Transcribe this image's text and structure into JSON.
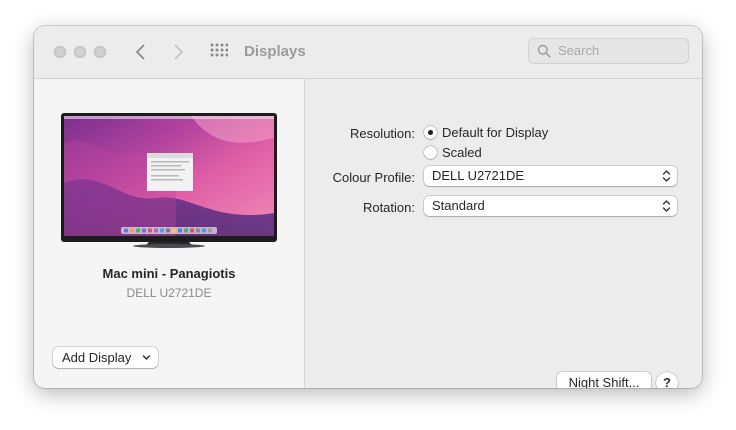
{
  "window": {
    "title": "Displays"
  },
  "toolbar": {
    "back_icon": "chevron-left-icon",
    "forward_icon": "chevron-right-icon",
    "grid_icon": "show-all-grid-icon"
  },
  "search": {
    "placeholder": "Search",
    "icon": "search-icon"
  },
  "display": {
    "name": "Mac mini - Panagiotis",
    "model": "DELL U2721DE"
  },
  "buttons": {
    "add_display": "Add Display",
    "night_shift": "Night Shift...",
    "help": "?"
  },
  "settings": {
    "resolution_label": "Resolution:",
    "resolution_options": [
      {
        "label": "Default for Display",
        "selected": true
      },
      {
        "label": "Scaled",
        "selected": false
      }
    ],
    "colour_profile_label": "Colour Profile:",
    "colour_profile_value": "DELL U2721DE",
    "rotation_label": "Rotation:",
    "rotation_value": "Standard"
  }
}
